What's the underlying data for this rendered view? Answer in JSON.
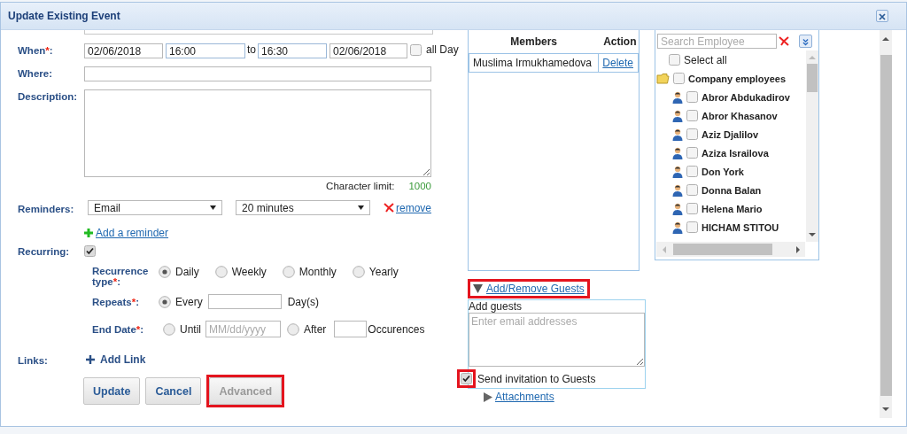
{
  "window": {
    "title": "Update Existing Event"
  },
  "form": {
    "when": {
      "label": "When",
      "mark": "*",
      "suffix": ":",
      "start_date": "02/06/2018",
      "start_time": "16:00",
      "separator": "to",
      "end_time": "16:30",
      "end_date": "02/06/2018",
      "all_day": {
        "label": "all Day",
        "checked": false
      }
    },
    "where": {
      "label": "Where:"
    },
    "description": {
      "label": "Description:"
    },
    "character_limit": {
      "label": "Character limit:",
      "value": "1000"
    },
    "reminders": {
      "label": "Reminders:",
      "method": "Email",
      "time": "20 minutes",
      "remove": "remove",
      "add": "Add a reminder"
    },
    "recurring": {
      "label": "Recurring:",
      "checked": true
    },
    "recurrence_type": {
      "label": "Recurrence type",
      "mark": "*",
      "suffix": ":",
      "options": [
        {
          "label": "Daily",
          "selected": true
        },
        {
          "label": "Weekly",
          "selected": false
        },
        {
          "label": "Monthly",
          "selected": false
        },
        {
          "label": "Yearly",
          "selected": false
        }
      ]
    },
    "repeats": {
      "label": "Repeats",
      "mark": "*",
      "suffix": ":",
      "option": {
        "label": "Every",
        "selected": true
      },
      "unit": "Day(s)"
    },
    "end_date": {
      "label": "End Date",
      "mark": "*",
      "suffix": ":",
      "options": [
        {
          "kind": "until",
          "label": "Until",
          "selected": false,
          "placeholder": "MM/dd/yyyy"
        },
        {
          "kind": "after",
          "label": "After",
          "selected": false,
          "unit": "Occurences"
        }
      ]
    },
    "links": {
      "label": "Links:",
      "add": "Add Link"
    },
    "buttons": [
      {
        "label": "Update",
        "disabled": false,
        "highlighted": false
      },
      {
        "label": "Cancel",
        "disabled": false,
        "highlighted": false
      },
      {
        "label": "Advanced",
        "disabled": true,
        "highlighted": true
      }
    ]
  },
  "members": {
    "columns": [
      "Members",
      "Action"
    ],
    "rows": [
      {
        "name": "Muslima Irmukhamedova",
        "action": "Delete"
      }
    ]
  },
  "guests": {
    "toggle": "Add/Remove Guests",
    "expanded": true,
    "highlighted": true,
    "label": "Add guests",
    "placeholder": "Enter email addresses",
    "send_invitation": {
      "label": "Send invitation to Guests",
      "checked": true,
      "highlighted": true
    },
    "attachments": {
      "label": "Attachments",
      "expanded": false
    }
  },
  "employees": {
    "search_placeholder": "Search Employee",
    "select_all": {
      "label": "Select all",
      "checked": false
    },
    "group": {
      "label": "Company employees",
      "checked": false,
      "children": [
        {
          "name": "Abror Abdukadirov",
          "checked": false
        },
        {
          "name": "Abror Khasanov",
          "checked": false
        },
        {
          "name": "Aziz Djalilov",
          "checked": false
        },
        {
          "name": "Aziza Israilova",
          "checked": false
        },
        {
          "name": "Don York",
          "checked": false
        },
        {
          "name": "Donna Balan",
          "checked": false
        },
        {
          "name": "Helena Mario",
          "checked": false
        },
        {
          "name": "HICHAM STITOU",
          "checked": false
        }
      ]
    }
  }
}
